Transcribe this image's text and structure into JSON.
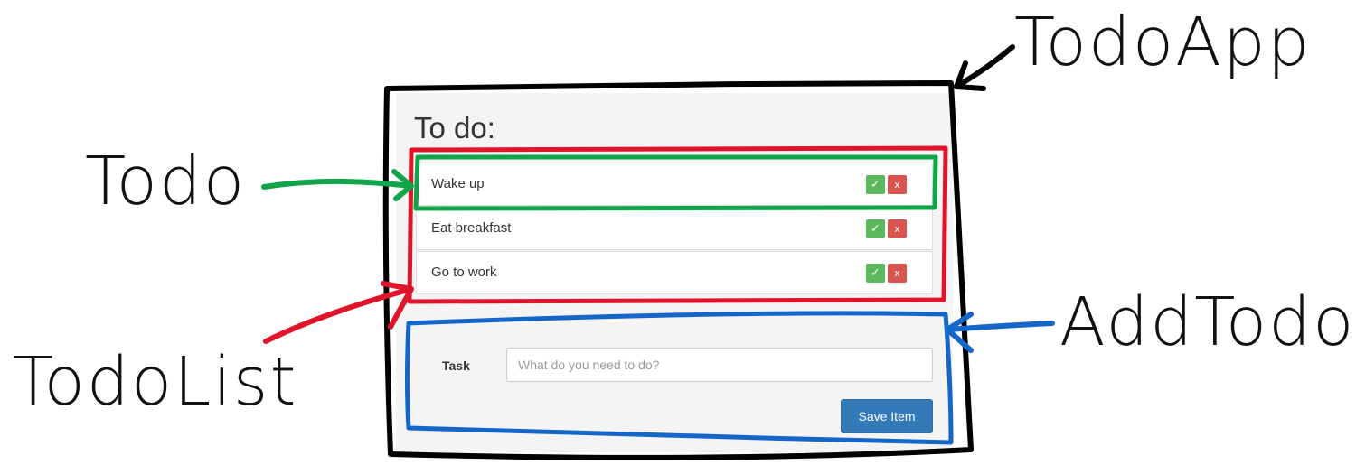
{
  "annotations": {
    "todoapp": "TodoApp",
    "todo": "Todo",
    "todolist": "TodoList",
    "addtodo": "AddTodo"
  },
  "app": {
    "title": "To do:",
    "todos": [
      {
        "text": "Wake up",
        "done_icon": "✓",
        "delete_icon": "x"
      },
      {
        "text": "Eat breakfast",
        "done_icon": "✓",
        "delete_icon": "x"
      },
      {
        "text": "Go to work",
        "done_icon": "✓",
        "delete_icon": "x"
      }
    ],
    "form": {
      "label": "Task",
      "placeholder": "What do you need to do?",
      "save_label": "Save Item"
    }
  },
  "colors": {
    "todoapp_outline": "#000000",
    "todo_outline": "#12a44a",
    "todolist_outline": "#e0142a",
    "addtodo_outline": "#1466c8",
    "done_button": "#5cb85c",
    "delete_button": "#d9534f",
    "save_button": "#337ab7"
  }
}
